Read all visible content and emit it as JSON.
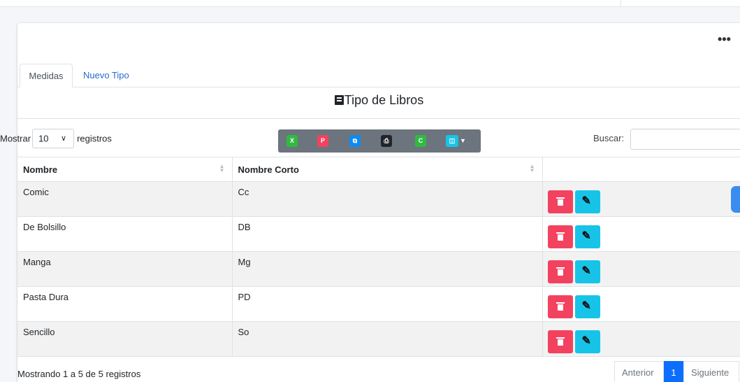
{
  "header": {
    "menu_icon": "ellipsis-icon"
  },
  "tabs": [
    {
      "label": "Medidas",
      "active": true
    },
    {
      "label": "Nuevo Tipo",
      "active": false
    }
  ],
  "title": {
    "icon": "book-icon",
    "text": "Tipo de Libros"
  },
  "length_control": {
    "prefix": "Mostrar",
    "value": "10",
    "suffix": "registros"
  },
  "export_buttons": [
    {
      "icon": "excel-icon",
      "color": "#2fbb3f"
    },
    {
      "icon": "pdf-icon",
      "color": "#f3425f"
    },
    {
      "icon": "copy-icon",
      "color": "#0d8bf2"
    },
    {
      "icon": "print-icon",
      "color": "#212529"
    },
    {
      "icon": "csv-icon",
      "color": "#2fbb3f"
    },
    {
      "icon": "columns-icon",
      "color": "#17c4e8"
    }
  ],
  "search": {
    "label": "Buscar:",
    "value": ""
  },
  "table": {
    "columns": [
      "Nombre",
      "Nombre Corto",
      ""
    ],
    "rows": [
      {
        "nombre": "Comic",
        "corto": "Cc"
      },
      {
        "nombre": "De Bolsillo",
        "corto": "DB"
      },
      {
        "nombre": "Manga",
        "corto": "Mg"
      },
      {
        "nombre": "Pasta Dura",
        "corto": "PD"
      },
      {
        "nombre": "Sencillo",
        "corto": "So"
      }
    ]
  },
  "footer": {
    "info": "Mostrando 1 a 5 de 5 registros",
    "prev": "Anterior",
    "page": "1",
    "next": "Siguiente"
  },
  "colors": {
    "delete": "#f3425f",
    "edit": "#17c4e8",
    "page_active": "#0d6efd",
    "link": "#2a6bcc"
  }
}
